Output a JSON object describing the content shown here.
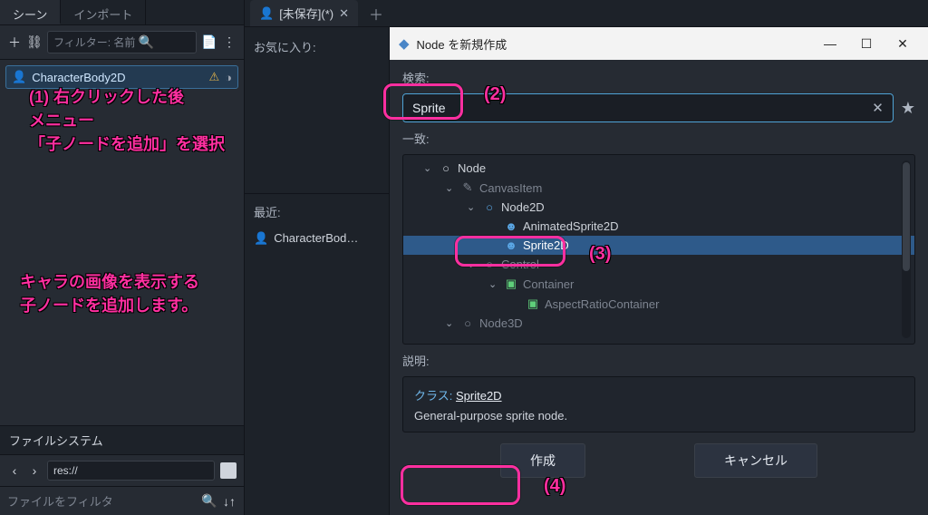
{
  "left": {
    "tabs": {
      "scene": "シーン",
      "import": "インポート"
    },
    "filter_placeholder": "フィルター: 名前",
    "root_node": "CharacterBody2D",
    "fs_title": "ファイルシステム",
    "fs_path": "res://",
    "fs_filter": "ファイルをフィルタ"
  },
  "main_tab": {
    "label": "[未保存](*)"
  },
  "favorites": {
    "label": "お気に入り:",
    "recent_label": "最近:",
    "recent_item": "CharacterBod…"
  },
  "dialog": {
    "title": "Node を新規作成",
    "search_label": "検索:",
    "search_value": "Sprite",
    "match_label": "一致:",
    "desc_label": "説明:",
    "class_label": "クラス:",
    "class_name": "Sprite2D",
    "class_desc": "General-purpose sprite node.",
    "create": "作成",
    "cancel": "キャンセル",
    "tree": {
      "node": "Node",
      "canvasitem": "CanvasItem",
      "node2d": "Node2D",
      "animsprite": "AnimatedSprite2D",
      "sprite2d": "Sprite2D",
      "control": "Control",
      "container": "Container",
      "aspect": "AspectRatioContainer",
      "node3d": "Node3D"
    }
  },
  "annotations": {
    "a1_l1": "(1) 右クリックした後",
    "a1_l2": "メニュー",
    "a1_l3": "「子ノードを追加」を選択",
    "a2": "(2)",
    "a3": "(3)",
    "a4": "(4)",
    "explain_l1": "キャラの画像を表示する",
    "explain_l2": "子ノードを追加します。"
  }
}
